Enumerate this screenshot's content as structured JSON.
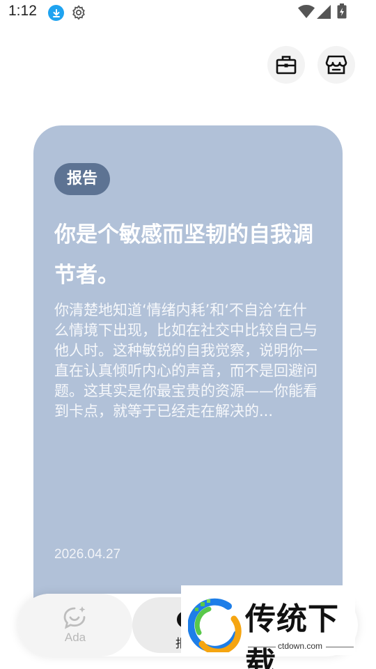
{
  "status_bar": {
    "time": "1:12",
    "icons": [
      "download-icon",
      "gear-icon",
      "wifi-icon",
      "signal-icon",
      "battery-icon"
    ]
  },
  "header": {
    "actions": [
      {
        "icon": "briefcase-icon"
      },
      {
        "icon": "store-icon"
      }
    ]
  },
  "card": {
    "badge": "报告",
    "title": "你是个敏感而坚韧的自我调节者。",
    "body": "你清楚地知道‘情绪内耗’和‘不自洽’在什么情境下出现，比如在社交中比较自己与他人时。这种敏锐的自我觉察，说明你一直在认真倾听内心的声音，而不是回避问题。这其实是你最宝贵的资源——你能看到卡点，就等于已经走在解决的...",
    "date": "2026.04.27",
    "background_color": "#b1c1d8",
    "badge_color": "#5d7393"
  },
  "bottom_nav": {
    "tabs": [
      {
        "label": "Ada",
        "icon": "chat-sparkle-icon"
      },
      {
        "label": "报",
        "icon": "dot-icon"
      }
    ]
  },
  "watermark": {
    "text": "传统下载",
    "url": "ctdown.com"
  }
}
